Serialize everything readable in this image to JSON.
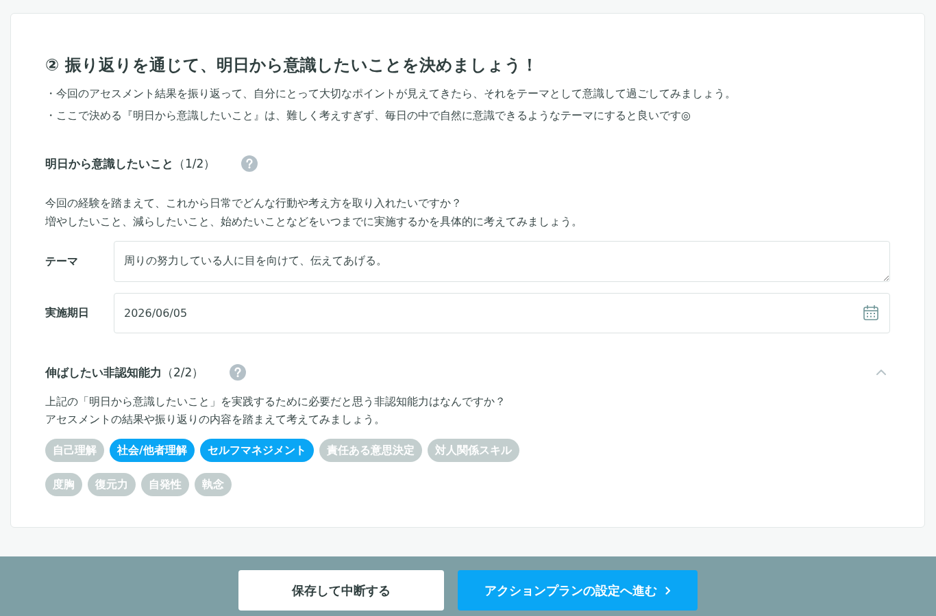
{
  "step_title": "② 振り返りを通じて、明日から意識したいことを決めましょう！",
  "intro_bullets": [
    "・今回のアセスメント結果を振り返って、自分にとって大切なポイントが見えてきたら、それをテーマとして意識して過ごしてみましょう。",
    "・ここで決める『明日から意識したいこと』は、難しく考えすぎず、毎日の中で自然に意識できるようなテーマにすると良いです◎"
  ],
  "sections": [
    {
      "kind": "form",
      "title": "**明日から意識したいこと**（1/2）",
      "description": [
        "今回の経験を踏まえて、これから日常でどんな行動や考え方を取り入れたいですか？",
        "増やしたいこと、減らしたいこと、始めたいことなどをいつまでに実施するかを具体的に考えてみましょう。"
      ],
      "fields": [
        {
          "kind": "textarea",
          "label": "テーマ",
          "value": "周りの努力している人に目を向けて、伝えてあげる。"
        },
        {
          "kind": "date",
          "label": "実施期日",
          "value": "2026/06/05"
        }
      ]
    },
    {
      "kind": "tags",
      "title": "**伸ばしたい非認知能力**（2/2）",
      "expanded": true,
      "description": [
        "上記の「明日から意識したいこと」を実践するために必要だと思う非認知能力はなんですか？",
        "アセスメントの結果や振り返りの内容を踏まえて考えてみましょう。"
      ],
      "tag_groups": [
        [
          {
            "label": "自己理解",
            "selected": false
          },
          {
            "label": "社会/他者理解",
            "selected": true
          },
          {
            "label": "セルフマネジメント",
            "selected": true
          },
          {
            "label": "責任ある意思決定",
            "selected": false
          },
          {
            "label": "対人関係スキル",
            "selected": false
          }
        ],
        [
          {
            "label": "度胸",
            "selected": false
          },
          {
            "label": "復元力",
            "selected": false
          },
          {
            "label": "自発性",
            "selected": false
          },
          {
            "label": "執念",
            "selected": false
          }
        ]
      ]
    }
  ],
  "footer": {
    "buttons": [
      {
        "kind": "secondary",
        "label": "保存して中断する"
      },
      {
        "kind": "primary",
        "label": "アクションプランの設定へ進む"
      }
    ]
  }
}
